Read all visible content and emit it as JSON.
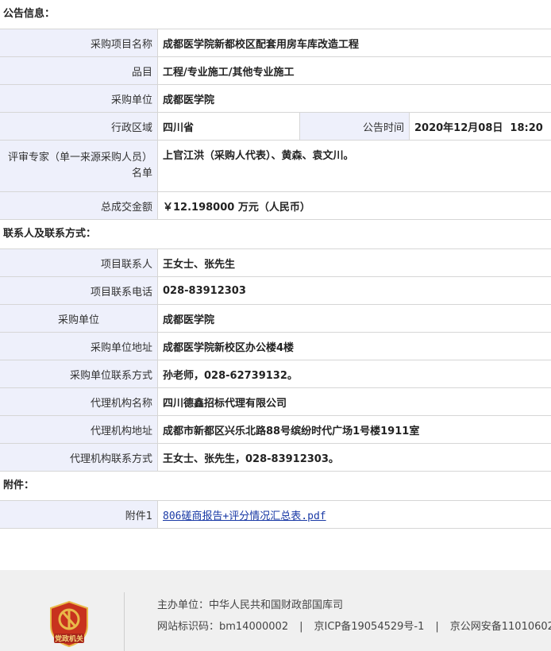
{
  "sections": {
    "announcement": "公告信息：",
    "contacts": "联系人及联系方式：",
    "attachments": "附件："
  },
  "announcement": {
    "project_name_label": "采购项目名称",
    "project_name": "成都医学院新都校区配套用房车库改造工程",
    "category_label": "品目",
    "category": "工程/专业施工/其他专业施工",
    "purchaser_label": "采购单位",
    "purchaser": "成都医学院",
    "region_label": "行政区域",
    "region": "四川省",
    "publish_time_label": "公告时间",
    "publish_time": "2020年12月08日  18:20",
    "experts_label": "评审专家（单一来源采购人员）名单",
    "experts": "上官江洪（采购人代表）、黄森、袁文川。",
    "amount_label": "总成交金额",
    "amount": "￥12.198000 万元（人民币）"
  },
  "contacts": {
    "project_contact_label": "项目联系人",
    "project_contact": "王女士、张先生",
    "project_phone_label": "项目联系电话",
    "project_phone": "028-83912303",
    "purchaser_label": "采购单位",
    "purchaser": "成都医学院",
    "purchaser_address_label": "采购单位地址",
    "purchaser_address": "成都医学院新校区办公楼4楼",
    "purchaser_contact_label": "采购单位联系方式",
    "purchaser_contact": "孙老师，028-62739132。",
    "agency_name_label": "代理机构名称",
    "agency_name": "四川德鑫招标代理有限公司",
    "agency_address_label": "代理机构地址",
    "agency_address": "成都市新都区兴乐北路88号缤纷时代广场1号楼1911室",
    "agency_contact_label": "代理机构联系方式",
    "agency_contact": "王女士、张先生，028-83912303。"
  },
  "attachments": {
    "label": "附件1",
    "file": "806磋商报告+评分情况汇总表.pdf"
  },
  "footer": {
    "sponsor": "主办单位：中华人民共和国财政部国库司",
    "site_id": "网站标识码：bm14000002",
    "icp": "京ICP备19054529号-1",
    "police": "京公网安备11010602",
    "emblem_text": "党政机关",
    "colors": {
      "emblem_red": "#c8321e",
      "emblem_gold": "#e9b949"
    }
  }
}
